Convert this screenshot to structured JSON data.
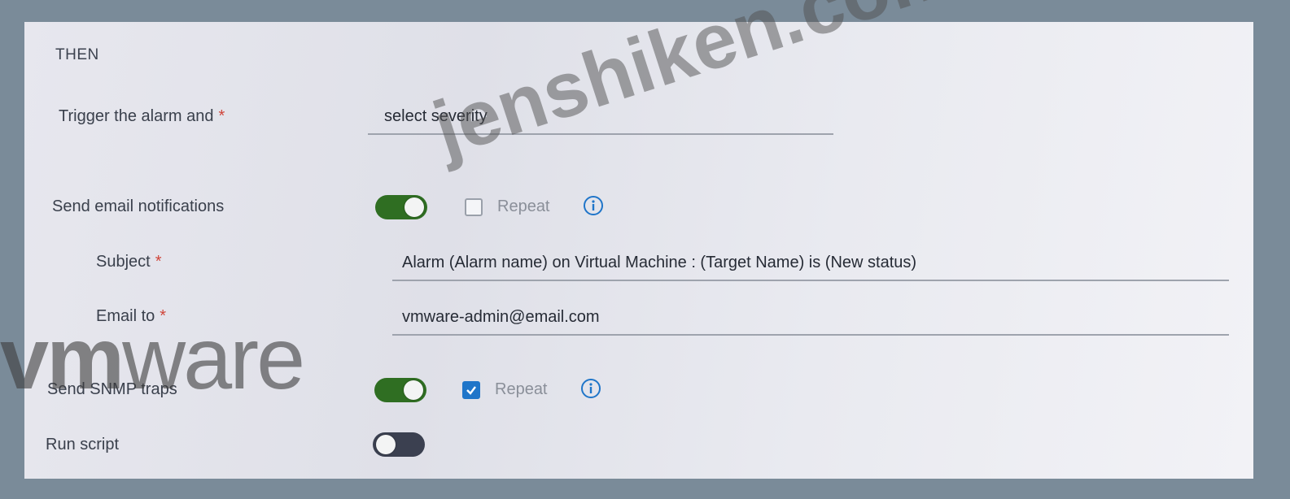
{
  "section": {
    "title": "THEN"
  },
  "trigger": {
    "label": "Trigger the alarm and",
    "required_mark": "*",
    "value": "select severity"
  },
  "email": {
    "label": "Send email notifications",
    "toggle_on": true,
    "repeat_label": "Repeat",
    "repeat_checked": false,
    "subject": {
      "label": "Subject",
      "required_mark": "*",
      "value": "Alarm (Alarm name) on Virtual Machine : (Target Name) is (New status)"
    },
    "email_to": {
      "label": "Email to",
      "required_mark": "*",
      "value": "vmware-admin@email.com"
    }
  },
  "snmp": {
    "label": "Send SNMP traps",
    "toggle_on": true,
    "repeat_label": "Repeat",
    "repeat_checked": true
  },
  "script": {
    "label": "Run script",
    "toggle_on": false
  },
  "watermark": {
    "brand_bold": "vm",
    "brand_light": "ware",
    "site": "jenshiken.com"
  },
  "colors": {
    "toggle_on": "#2f6e22",
    "toggle_off": "#3b4050",
    "checkbox_checked": "#1f75c9",
    "info_icon": "#1f75c9",
    "required": "#d0453a"
  }
}
